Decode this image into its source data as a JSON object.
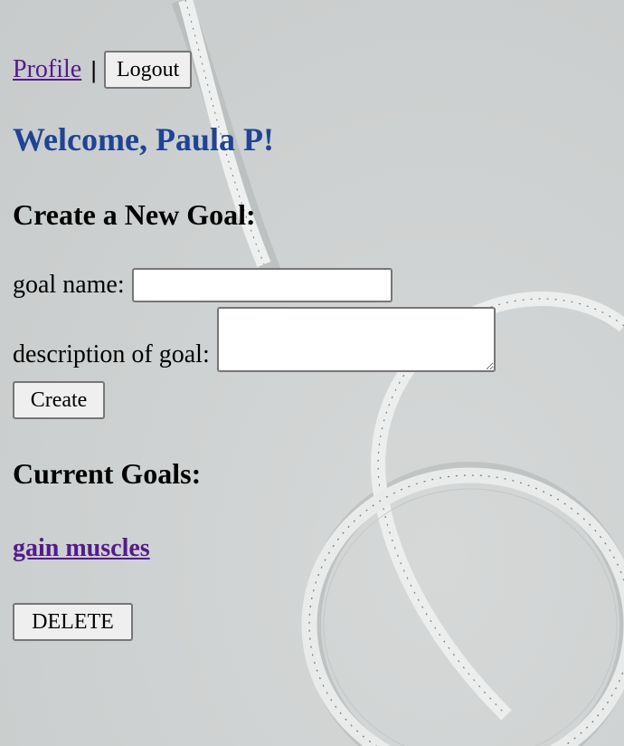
{
  "nav": {
    "profile_link": "Profile",
    "separator": "|",
    "logout_label": "Logout"
  },
  "welcome": {
    "text": "Welcome, Paula P!"
  },
  "create_goal": {
    "heading": "Create a New Goal:",
    "name_label": "goal name:",
    "name_value": "",
    "description_label": "description of goal:",
    "description_value": "",
    "create_label": "Create"
  },
  "current_goals": {
    "heading": "Current Goals:",
    "goals": [
      {
        "name": "gain muscles",
        "delete_label": "DELETE"
      }
    ]
  },
  "colors": {
    "welcome": "#1f4494",
    "link_visited": "#551a8b",
    "background": "#cfd2d2"
  }
}
